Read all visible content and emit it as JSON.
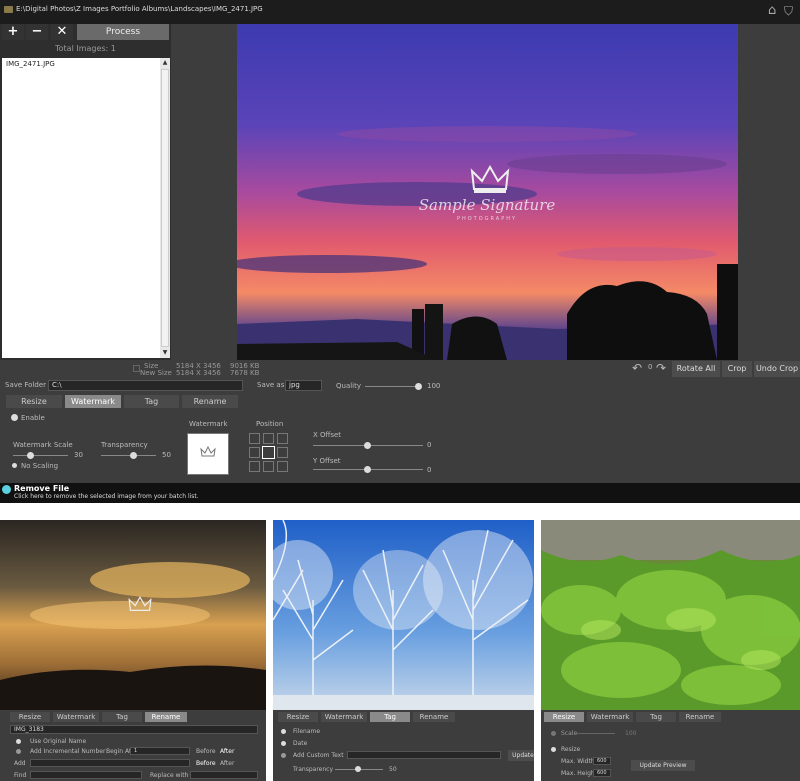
{
  "window": {
    "title": "E:\\Digital Photos\\Z Images Portfolio Albums\\Landscapes\\IMG_2471.JPG",
    "home_icon": "home-icon",
    "shield_icon": "shield-icon"
  },
  "toolbar": {
    "add_label": "+",
    "remove_label": "−",
    "clear_label": "✕",
    "process_label": "Process"
  },
  "file_list": {
    "total_label": "Total Images: 1",
    "items": [
      "IMG_2471.JPG"
    ]
  },
  "watermark_overlay": {
    "signature": "Sample Signature",
    "subtitle": "PHOTOGRAPHY"
  },
  "info": {
    "size_label": "Size",
    "size_value": "5184 X 3456",
    "size_kb": "9016 KB",
    "new_size_label": "New Size",
    "new_size_value": "5184 X 3456",
    "new_size_kb": "7678 KB"
  },
  "actions": {
    "rotate_count": "0",
    "rotate_all": "Rotate All",
    "crop": "Crop",
    "undo_crop": "Undo Crop"
  },
  "save": {
    "folder_label": "Save Folder",
    "folder_value": "C:\\",
    "save_as_label": "Save as",
    "format": "jpg",
    "quality_label": "Quality",
    "quality_value": "100"
  },
  "tabs": [
    "Resize",
    "Watermark",
    "Tag",
    "Rename"
  ],
  "watermark": {
    "enable_label": "Enable",
    "scale_label": "Watermark Scale",
    "scale_value": "30",
    "transparency_label": "Transparency",
    "transparency_value": "50",
    "no_scaling_label": "No Scaling",
    "preview_label": "Watermark",
    "position_label": "Position",
    "x_offset_label": "X Offset",
    "x_offset_value": "0",
    "y_offset_label": "Y Offset",
    "y_offset_value": "0"
  },
  "status": {
    "title": "Remove File",
    "message": "Click here to remove the selected image from your batch list."
  },
  "shot1": {
    "tabs": [
      "Resize",
      "Watermark",
      "Tag",
      "Rename"
    ],
    "file_value": "IMG_3183",
    "use_original": "Use Original Name",
    "add_incremental": "Add Incremental Number",
    "begin_at": "Begin At",
    "begin_value": "1",
    "before": "Before",
    "after": "After",
    "add_label": "Add",
    "find_label": "Find",
    "replace_label": "Replace with"
  },
  "shot2": {
    "tabs": [
      "Resize",
      "Watermark",
      "Tag",
      "Rename"
    ],
    "filename": "Filename",
    "date": "Date",
    "custom_text": "Add Custom Text",
    "update": "Update",
    "transparency": "Transparency",
    "transparency_value": "50"
  },
  "shot3": {
    "tabs": [
      "Resize",
      "Watermark",
      "Tag",
      "Rename"
    ],
    "scale": "Scale",
    "scale_value": "100",
    "resize": "Resize",
    "max_width": "Max. Width",
    "max_width_value": "600",
    "max_height": "Max. Height",
    "max_height_value": "600",
    "update_preview": "Update Preview"
  }
}
